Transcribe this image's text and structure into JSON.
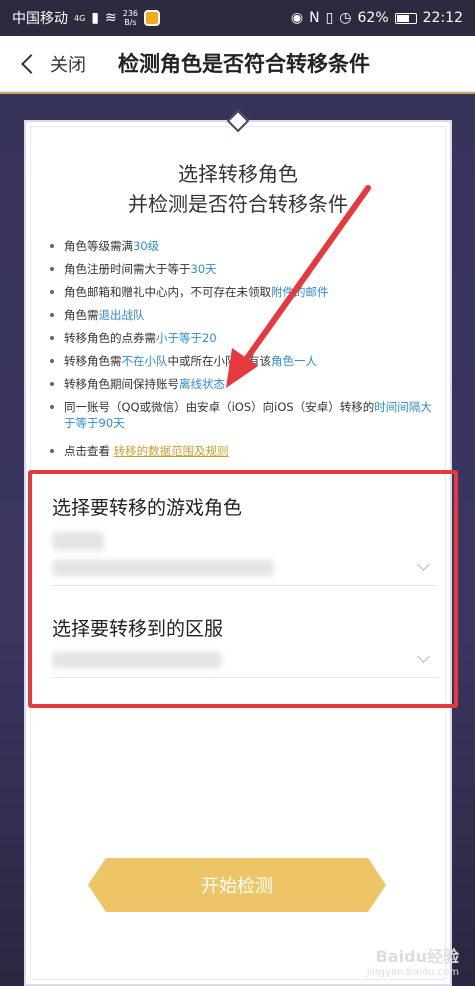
{
  "status_bar": {
    "carrier": "中国移动",
    "network": "4G",
    "speed_value": "236",
    "speed_unit": "B/s",
    "battery": "62%",
    "time": "22:12"
  },
  "header": {
    "back_label": "关闭",
    "title": "检测角色是否符合转移条件"
  },
  "card": {
    "title_line1": "选择转移角色",
    "title_line2": "并检测是否符合转移条件",
    "rules": [
      {
        "pre": "角色等级需满",
        "hl": "30级",
        "post": ""
      },
      {
        "pre": "角色注册时间需大于等于",
        "hl": "30天",
        "post": ""
      },
      {
        "pre": "角色邮箱和赠礼中心内，不可存在未领取",
        "hl": "附件的邮件",
        "post": ""
      },
      {
        "pre": "角色需",
        "hl": "退出战队",
        "post": ""
      },
      {
        "pre": "转移角色的点券需",
        "hl": "小于等于20",
        "post": ""
      },
      {
        "pre": "转移角色需",
        "hl": "不在小队",
        "post": "中或所在小队仅有该",
        "hl2": "角色一人"
      },
      {
        "pre": "转移角色期间保持账号",
        "hl": "离线状态",
        "post": ""
      },
      {
        "pre": "同一账号（QQ或微信）由安卓（iOS）向iOS（安卓）转移的",
        "hl": "时间间隔大于等于90天",
        "post": ""
      }
    ],
    "link_prefix": "点击查看",
    "link_text": "转移的数据范围及规则"
  },
  "section_role": {
    "title_pre": "选择要",
    "title_hl": "转移",
    "title_post": "的游戏角色"
  },
  "section_server": {
    "title_pre": "选择要",
    "title_hl": "转移到",
    "title_post": "的区服"
  },
  "start_button": "开始检测",
  "watermark": {
    "main": "Baidu经验",
    "sub": "jingyan.baidu.com"
  }
}
